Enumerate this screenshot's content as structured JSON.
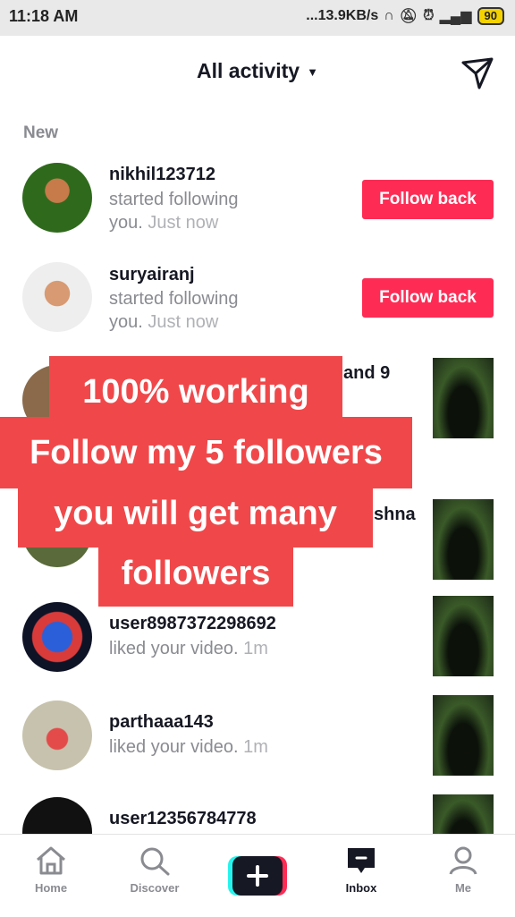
{
  "status_bar": {
    "time": "11:18 AM",
    "network_speed": "...13.9KB/s",
    "battery": "90",
    "network_type": "4G"
  },
  "header": {
    "title": "All activity",
    "send_icon": "paper-plane-icon"
  },
  "section_label": "New",
  "notifications": [
    {
      "username": "nikhil123712",
      "action": "started following",
      "action2": "you.",
      "time": "Just now",
      "button": "Follow back"
    },
    {
      "username": "suryairanj",
      "action": "started following",
      "action2": "you.",
      "time": "Just now",
      "button": "Follow back"
    },
    {
      "partial_text": "and 9"
    },
    {
      "partial_text": "shna"
    },
    {
      "username": "user8987372298692",
      "action": "liked your video.",
      "time": "1m"
    },
    {
      "username": "parthaaa143",
      "action": "liked your video.",
      "time": "1m"
    },
    {
      "username": "user12356784778"
    }
  ],
  "overlay": {
    "line1": "100% working",
    "line2": "Follow my 5 followers",
    "line3": "you will get many",
    "line4": "followers"
  },
  "nav": {
    "items": [
      {
        "label": "Home",
        "icon": "home-icon"
      },
      {
        "label": "Discover",
        "icon": "search-icon"
      },
      {
        "label": "Inbox",
        "icon": "inbox-icon",
        "active": true
      },
      {
        "label": "Me",
        "icon": "user-icon"
      }
    ],
    "create_icon": "plus-icon"
  },
  "colors": {
    "accent": "#fe2c55",
    "overlay": "#f0484a",
    "text_primary": "#161823",
    "text_secondary": "#8a8b91"
  }
}
